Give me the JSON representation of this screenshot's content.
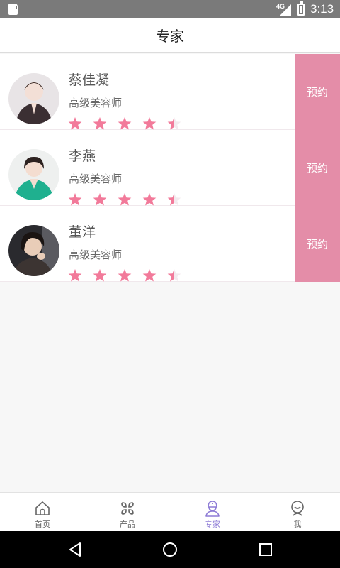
{
  "status_bar": {
    "network": "4G",
    "time": "3:13"
  },
  "header": {
    "title": "专家"
  },
  "experts": [
    {
      "name": "蔡佳凝",
      "title": "高级美容师",
      "rating": 4.5,
      "book_label": "预约",
      "avatar": "avatar-woman-dark-jacket"
    },
    {
      "name": "李燕",
      "title": "高级美容师",
      "rating": 4.5,
      "book_label": "预约",
      "avatar": "avatar-woman-teal-top"
    },
    {
      "name": "董洋",
      "title": "高级美容师",
      "rating": 4.5,
      "book_label": "预约",
      "avatar": "avatar-woman-dark-background"
    }
  ],
  "tabs": [
    {
      "label": "首页",
      "icon": "home-icon",
      "active": false
    },
    {
      "label": "产品",
      "icon": "grid-icon",
      "active": false
    },
    {
      "label": "专家",
      "icon": "doctor-icon",
      "active": true
    },
    {
      "label": "我",
      "icon": "profile-icon",
      "active": false
    }
  ],
  "colors": {
    "accent": "#e48da8",
    "star": "#f27a9a",
    "active_tab": "#8e7cd6"
  }
}
